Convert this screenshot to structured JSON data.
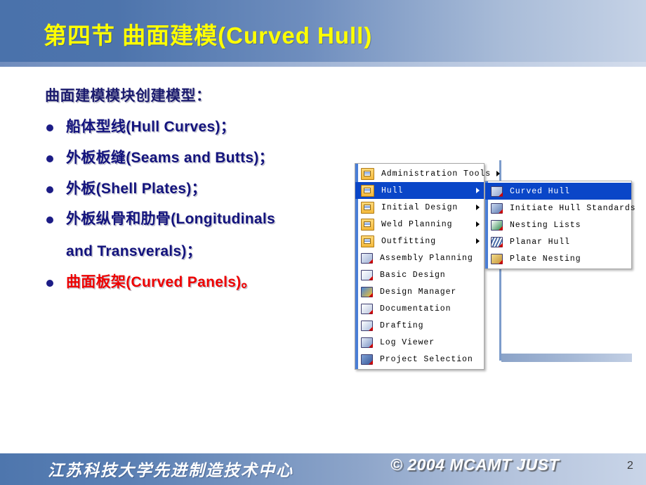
{
  "header": {
    "title": "第四节 曲面建模(Curved Hull)",
    "title_color": "#ffff00",
    "band_start_color": "#4a72ab",
    "band_end_color": "#c5d2e6"
  },
  "body": {
    "lead": "曲面建模模块创建模型：",
    "bullets": [
      {
        "text": "船体型线(Hull Curves)；",
        "color": "#13137d"
      },
      {
        "text": "外板板缝(Seams and Butts)；",
        "color": "#13137d"
      },
      {
        "text": "外板(Shell Plates)；",
        "color": "#13137d"
      },
      {
        "text": "外板纵骨和肋骨(Longitudinals",
        "color": "#13137d",
        "continuation": "and Transverals)；"
      },
      {
        "text": "曲面板架(Curved Panels)。",
        "color": "#ee0000"
      }
    ]
  },
  "menu_main": {
    "items": [
      {
        "label": "Administration Tools",
        "icon": "folder-icon",
        "has_submenu": true,
        "selected": false
      },
      {
        "label": "Hull",
        "icon": "folder-icon",
        "has_submenu": true,
        "selected": true
      },
      {
        "label": "Initial Design",
        "icon": "folder-icon",
        "has_submenu": true,
        "selected": false
      },
      {
        "label": "Weld Planning",
        "icon": "folder-icon",
        "has_submenu": true,
        "selected": false
      },
      {
        "label": "Outfitting",
        "icon": "folder-icon",
        "has_submenu": true,
        "selected": false
      },
      {
        "label": "Assembly Planning",
        "icon": "assembly-planning-icon",
        "has_submenu": false,
        "selected": false
      },
      {
        "label": "Basic Design",
        "icon": "basic-design-icon",
        "has_submenu": false,
        "selected": false
      },
      {
        "label": "Design Manager",
        "icon": "design-manager-icon",
        "has_submenu": false,
        "selected": false
      },
      {
        "label": "Documentation",
        "icon": "documentation-icon",
        "has_submenu": false,
        "selected": false
      },
      {
        "label": "Drafting",
        "icon": "drafting-icon",
        "has_submenu": false,
        "selected": false
      },
      {
        "label": "Log Viewer",
        "icon": "log-viewer-icon",
        "has_submenu": false,
        "selected": false
      },
      {
        "label": "Project Selection",
        "icon": "project-selection-icon",
        "has_submenu": false,
        "selected": false
      }
    ]
  },
  "menu_sub": {
    "items": [
      {
        "label": "Curved Hull",
        "icon": "curved-hull-icon",
        "selected": true
      },
      {
        "label": "Initiate Hull Standards",
        "icon": "initiate-hull-icon",
        "selected": false
      },
      {
        "label": "Nesting Lists",
        "icon": "nesting-lists-icon",
        "selected": false
      },
      {
        "label": "Planar Hull",
        "icon": "planar-hull-icon",
        "selected": false
      },
      {
        "label": "Plate Nesting",
        "icon": "plate-nesting-icon",
        "selected": false
      }
    ],
    "highlight_color": "#0a46c8"
  },
  "footer": {
    "organization": "江苏科技大学先进制造技术中心",
    "copyright": "© 2004 MCAMT JUST",
    "slide_number": "2"
  }
}
